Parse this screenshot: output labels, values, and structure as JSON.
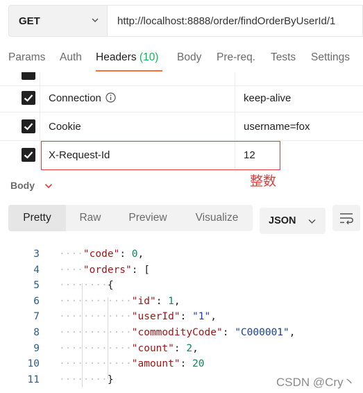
{
  "request": {
    "method": "GET",
    "url": "http://localhost:8888/order/findOrderByUserId/1"
  },
  "tabs": [
    {
      "label": "Params"
    },
    {
      "label": "Auth"
    },
    {
      "label": "Headers ",
      "count": "(10)"
    },
    {
      "label": "Body"
    },
    {
      "label": "Pre-req."
    },
    {
      "label": "Tests"
    },
    {
      "label": "Settings"
    }
  ],
  "headers": [
    {
      "key": "Connection",
      "value": "keep-alive"
    },
    {
      "key": "Cookie",
      "value": "username=fox"
    },
    {
      "key": "X-Request-Id",
      "value": "12"
    }
  ],
  "annotation": "整数",
  "response": {
    "body_label": "Body",
    "view_modes": [
      "Pretty",
      "Raw",
      "Preview",
      "Visualize"
    ],
    "format": "JSON"
  },
  "code_lines": [
    {
      "num": "3"
    },
    {
      "num": "4"
    },
    {
      "num": "5"
    },
    {
      "num": "6"
    },
    {
      "num": "7"
    },
    {
      "num": "8"
    },
    {
      "num": "9"
    },
    {
      "num": "10"
    },
    {
      "num": "11"
    }
  ],
  "code": {
    "code_key": "\"code\"",
    "code_val": "0",
    "orders_key": "\"orders\"",
    "id_key": "\"id\"",
    "id_val": "1",
    "userId_key": "\"userId\"",
    "userId_val": "\"1\"",
    "commodity_key": "\"commodityCode\"",
    "commodity_val": "\"C000001\"",
    "count_key": "\"count\"",
    "count_val": "2",
    "amount_key": "\"amount\"",
    "amount_val": "20"
  },
  "watermark": "CSDN @Cry丶",
  "colors": {
    "accent": "#ff6c37",
    "count": "#0cbb52",
    "annotation": "#e03a3a"
  }
}
